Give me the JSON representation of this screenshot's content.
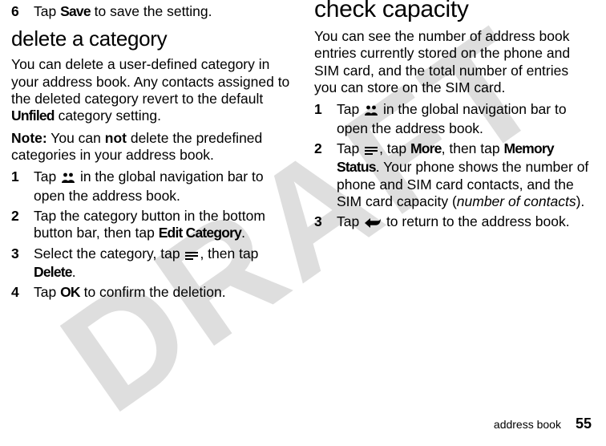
{
  "watermark": "DRAFT",
  "left": {
    "step6_num": "6",
    "step6": {
      "pre": "Tap ",
      "btn": "Save",
      "post": " to save the setting."
    },
    "heading": "delete a category",
    "intro": {
      "pre": "You can delete a user-defined category in your address book. Any contacts assigned to the deleted category revert to the default ",
      "unfiled": "Unfiled",
      "post": " category setting."
    },
    "note": {
      "label": "Note:",
      "pre": " You can ",
      "not": "not",
      "post": " delete the predefined categories in your address book."
    },
    "s1_num": "1",
    "s1": {
      "pre": "Tap ",
      "post": " in the global navigation bar to open the address book."
    },
    "s2_num": "2",
    "s2": {
      "pre": "Tap the category button in the bottom button bar, then tap ",
      "btn": "Edit Category",
      "post": "."
    },
    "s3_num": "3",
    "s3": {
      "pre": "Select the category, tap ",
      "post1": ", then tap ",
      "btn": "Delete",
      "post2": "."
    },
    "s4_num": "4",
    "s4": {
      "pre": "Tap ",
      "btn": "OK",
      "post": " to confirm the deletion."
    }
  },
  "right": {
    "heading": "check capacity",
    "intro": "You can see the number of address book entries currently stored on the phone and SIM card, and the total number of entries you can store on the SIM card.",
    "s1_num": "1",
    "s1": {
      "pre": "Tap ",
      "post": " in the global navigation bar to open the address book."
    },
    "s2_num": "2",
    "s2": {
      "pre": "Tap ",
      "mid1": ", tap ",
      "more": "More",
      "mid2": ", then tap ",
      "mem": "Memory Status",
      "post": ". Your phone shows the number of phone and SIM card contacts, and the SIM card capacity (",
      "italic": "number of contacts",
      "close": ")."
    },
    "s3_num": "3",
    "s3": {
      "pre": "Tap ",
      "post": " to return to the address book."
    }
  },
  "footer": {
    "section": "address book",
    "page": "55"
  }
}
